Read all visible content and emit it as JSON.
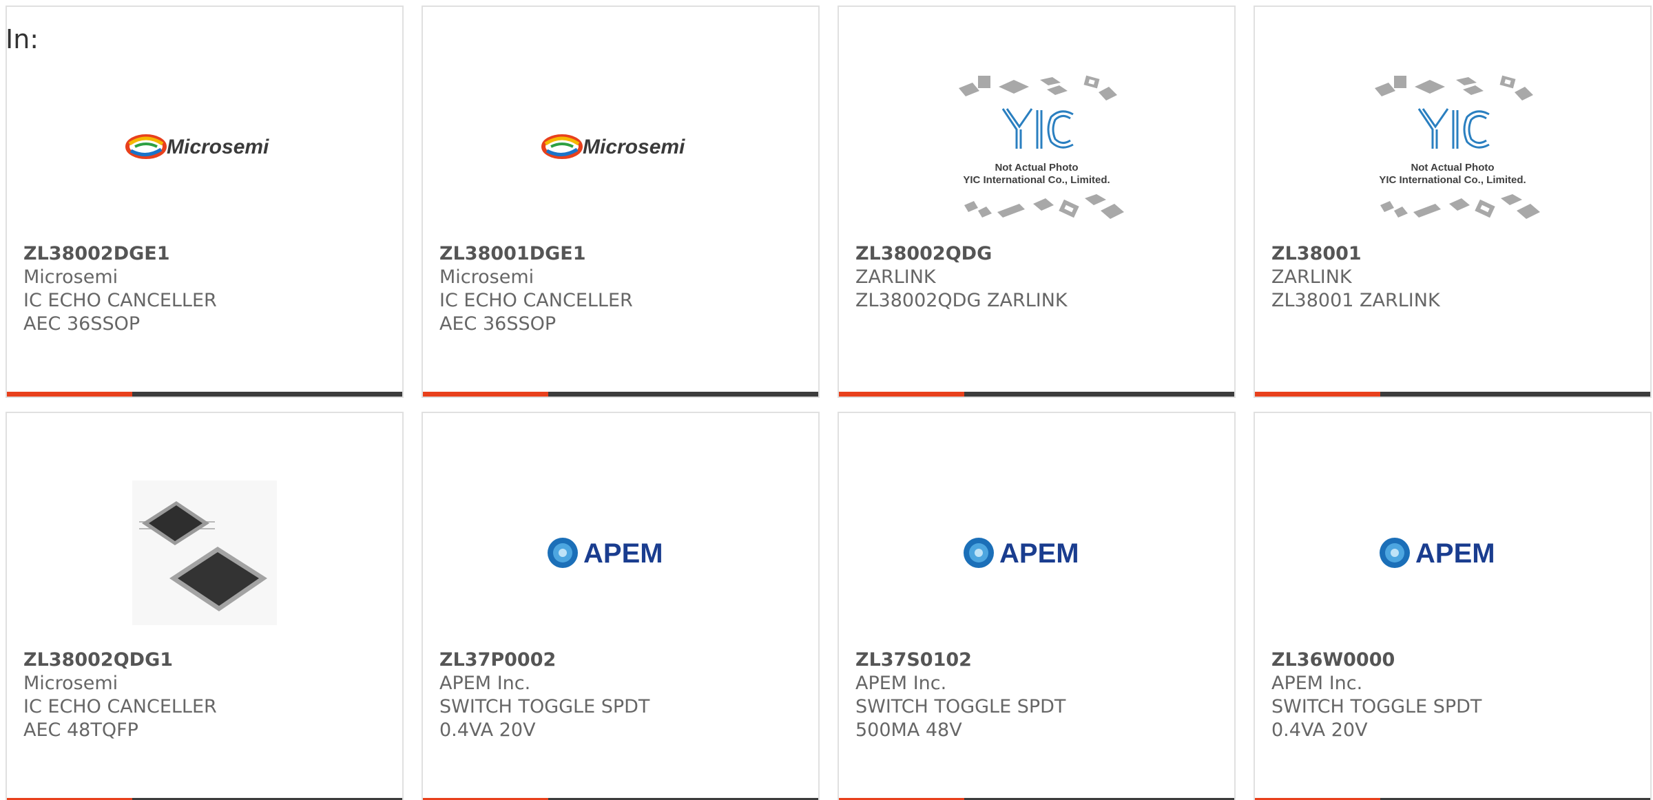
{
  "heading": "In:",
  "colors": {
    "accent": "#e8401c",
    "bar": "#3c3c3c",
    "card_border": "#e0e0e0",
    "microsemi_text": "#3a3a3a",
    "apem_blue": "#1a3d8f",
    "yic_blue": "#2a7fc0"
  },
  "cards": [
    {
      "image": "microsemi-logo",
      "logo_text": "Microsemi",
      "part_number": "ZL38002DGE1",
      "manufacturer": "Microsemi",
      "description": "IC ECHO CANCELLER AEC 36SSOP"
    },
    {
      "image": "microsemi-logo",
      "logo_text": "Microsemi",
      "part_number": "ZL38001DGE1",
      "manufacturer": "Microsemi",
      "description": "IC ECHO CANCELLER AEC 36SSOP"
    },
    {
      "image": "yic-placeholder-photo",
      "logo_text": "YIC",
      "photo_caption_1": "Not Actual Photo",
      "photo_caption_2": "YIC International Co., Limited.",
      "part_number": "ZL38002QDG",
      "manufacturer": "ZARLINK",
      "description": "ZL38002QDG ZARLINK"
    },
    {
      "image": "yic-placeholder-photo",
      "logo_text": "YIC",
      "photo_caption_1": "Not Actual Photo",
      "photo_caption_2": "YIC International Co., Limited.",
      "part_number": "ZL38001",
      "manufacturer": "ZARLINK",
      "description": "ZL38001 ZARLINK"
    },
    {
      "image": "tqfp-chip-photo",
      "part_number": "ZL38002QDG1",
      "manufacturer": "Microsemi",
      "description": "IC ECHO CANCELLER AEC 48TQFP"
    },
    {
      "image": "apem-logo",
      "logo_text": "APEM",
      "part_number": "ZL37P0002",
      "manufacturer": "APEM Inc.",
      "description": "SWITCH TOGGLE SPDT 0.4VA 20V"
    },
    {
      "image": "apem-logo",
      "logo_text": "APEM",
      "part_number": "ZL37S0102",
      "manufacturer": "APEM Inc.",
      "description": "SWITCH TOGGLE SPDT 500MA 48V"
    },
    {
      "image": "apem-logo",
      "logo_text": "APEM",
      "part_number": "ZL36W0000",
      "manufacturer": "APEM Inc.",
      "description": "SWITCH TOGGLE SPDT 0.4VA 20V"
    }
  ]
}
